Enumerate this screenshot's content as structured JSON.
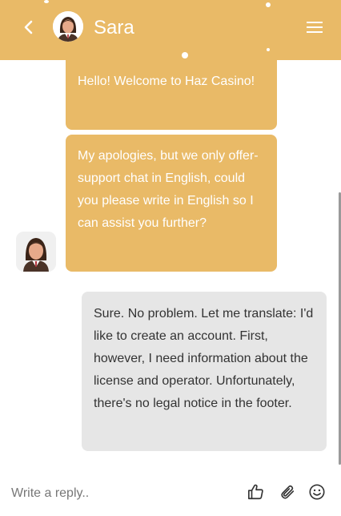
{
  "header": {
    "agent_name": "Sara",
    "back_icon": "chevron-left-icon",
    "menu_icon": "hamburger-menu-icon",
    "background_color": "#e9ba67"
  },
  "messages": [
    {
      "sender": "agent",
      "text": "Hello! Welcome to Haz Casino!"
    },
    {
      "sender": "agent",
      "text": "My apologies, but we only offer-support chat in English, could you please write in English so I can assist you further?"
    },
    {
      "sender": "user",
      "text": "Sure. No problem. Let me translate: I'd like to create an account. First, however, I need information about the license and operator. Unfortunately, there's no legal notice in the footer."
    }
  ],
  "composer": {
    "placeholder": "Write a reply..",
    "value": "",
    "icons": [
      "thumbs-up-icon",
      "paperclip-icon",
      "emoji-icon"
    ]
  },
  "colors": {
    "agent_bubble": "#e9ba67",
    "user_bubble": "#e6e6e6",
    "user_text": "#333333"
  }
}
